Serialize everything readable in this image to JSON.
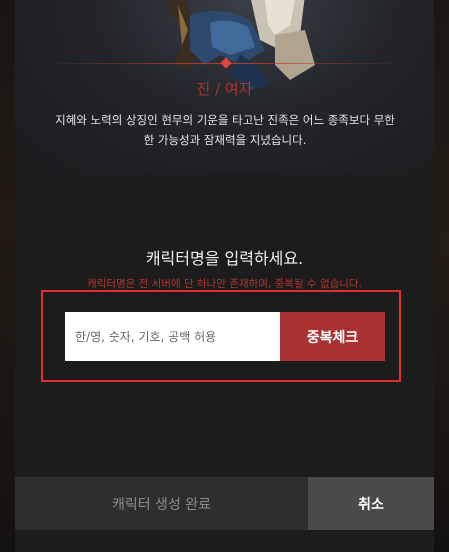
{
  "race": {
    "name": "진 / 여자",
    "description_line1": "지혜와 노력의 상징인 현무의 기운을 타고난 진족은 어느 종족보다 무한",
    "description_line2": "한 가능성과 잠재력을 지녔습니다."
  },
  "name_form": {
    "title": "캐릭터명을 입력하세요.",
    "note": "캐릭터명은 전 서버에 단 하나만 존재하며, 중복될 수 없습니다.",
    "input_placeholder": "한/영, 숫자, 기호, 공백 허용",
    "input_value": "",
    "check_label": "중복체크"
  },
  "footer": {
    "complete_label": "캐릭터 생성 완료",
    "cancel_label": "취소"
  },
  "colors": {
    "accent_red": "#c0392b",
    "check_button": "#a83231",
    "highlight": "#e0302a"
  }
}
